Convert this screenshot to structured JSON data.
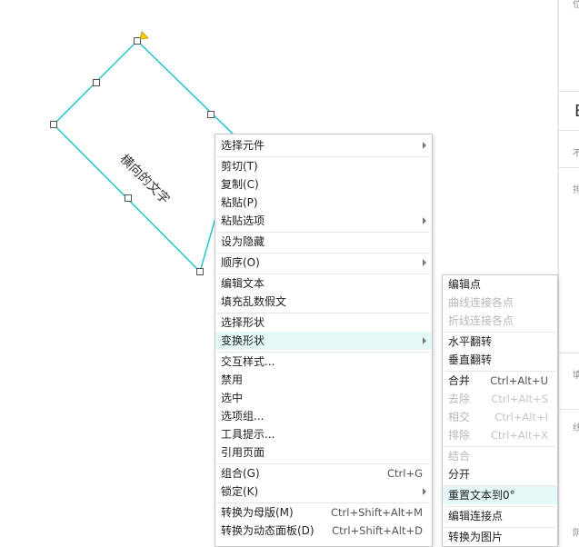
{
  "canvas": {
    "shape_text": "横向的文字",
    "accent_color": "#1fc5c9"
  },
  "right_panel": {
    "glyph_top": "位",
    "big_letter": "E",
    "labels": [
      "不",
      "排",
      "填",
      "线",
      "阴"
    ]
  },
  "context_menu": {
    "items": [
      {
        "label": "选择元件",
        "submenu": true
      },
      {
        "label": "剪切(T)"
      },
      {
        "label": "复制(C)"
      },
      {
        "label": "粘贴(P)"
      },
      {
        "label": "粘贴选项",
        "submenu": true
      },
      {
        "label": "设为隐藏"
      },
      {
        "label": "顺序(O)",
        "submenu": true
      },
      {
        "label": "编辑文本"
      },
      {
        "label": "填充乱数假文"
      },
      {
        "label": "选择形状"
      },
      {
        "label": "变换形状",
        "submenu": true,
        "highlighted": true
      },
      {
        "label": "交互样式..."
      },
      {
        "label": "禁用"
      },
      {
        "label": "选中"
      },
      {
        "label": "选项组..."
      },
      {
        "label": "工具提示..."
      },
      {
        "label": "引用页面"
      },
      {
        "label": "组合(G)",
        "shortcut": "Ctrl+G"
      },
      {
        "label": "锁定(K)",
        "submenu": true
      },
      {
        "label": "转换为母版(M)",
        "shortcut": "Ctrl+Shift+Alt+M"
      },
      {
        "label": "转换为动态面板(D)",
        "shortcut": "Ctrl+Shift+Alt+D"
      }
    ]
  },
  "submenu": {
    "items": [
      {
        "label": "编辑点"
      },
      {
        "label": "曲线连接各点",
        "disabled": true
      },
      {
        "label": "折线连接各点",
        "disabled": true
      },
      {
        "label": "水平翻转"
      },
      {
        "label": "垂直翻转"
      },
      {
        "label": "合并",
        "shortcut": "Ctrl+Alt+U"
      },
      {
        "label": "去除",
        "shortcut": "Ctrl+Alt+S",
        "disabled": true
      },
      {
        "label": "相交",
        "shortcut": "Ctrl+Alt+I",
        "disabled": true
      },
      {
        "label": "排除",
        "shortcut": "Ctrl+Alt+X",
        "disabled": true
      },
      {
        "label": "结合",
        "disabled": true
      },
      {
        "label": "分开"
      },
      {
        "label": "重置文本到0°",
        "highlighted": true
      },
      {
        "label": "编辑连接点"
      },
      {
        "label": "转换为图片"
      }
    ]
  }
}
